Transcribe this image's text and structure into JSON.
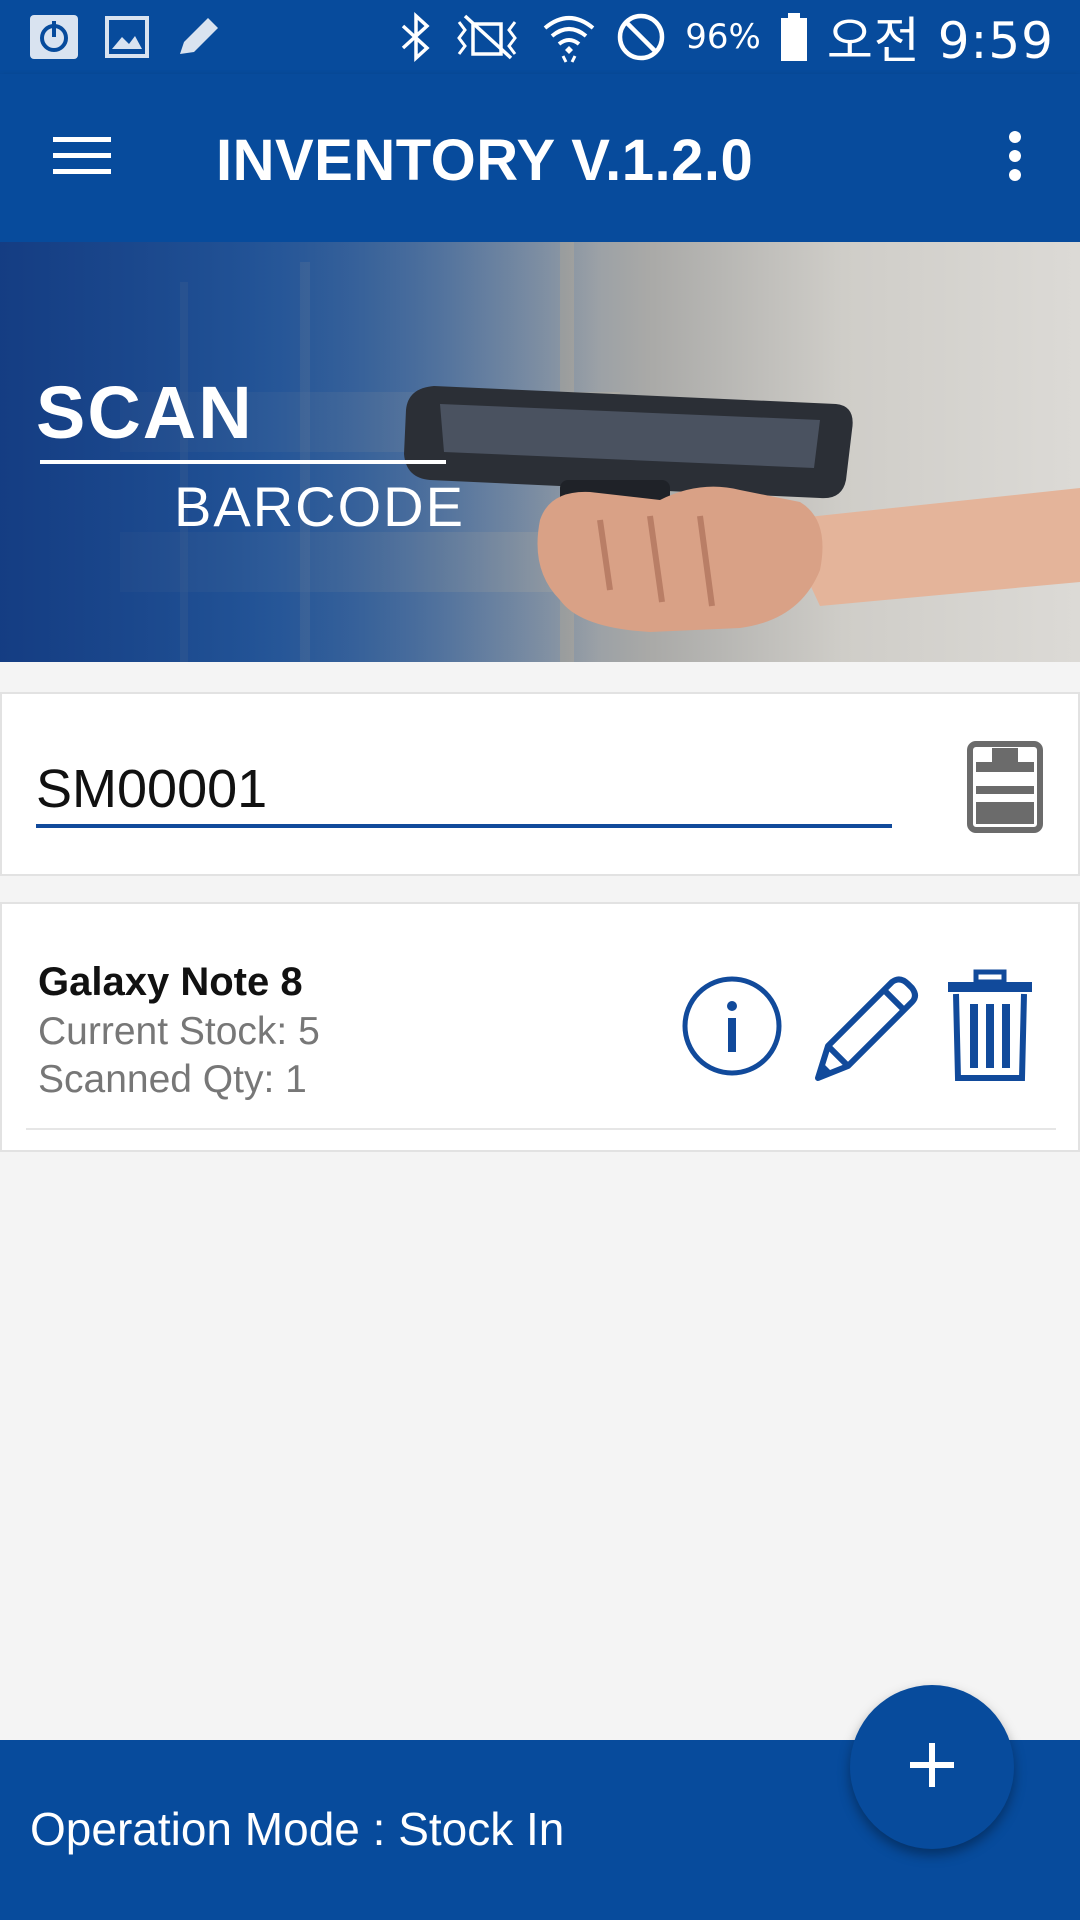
{
  "status_bar": {
    "left_icons": [
      "power-icon",
      "image-icon",
      "pencil-icon"
    ],
    "right_icons": [
      "bluetooth-icon",
      "vibrate-off-icon",
      "wifi-icon",
      "do-not-disturb-icon",
      "battery-icon"
    ],
    "battery_percent": "96%",
    "time": "오전 9:59"
  },
  "app_bar": {
    "title": "INVENTORY V.1.2.0",
    "menu_icon": "hamburger-menu-icon",
    "overflow_icon": "more-vert-icon"
  },
  "banner": {
    "title": "SCAN",
    "subtitle": "BARCODE"
  },
  "barcode": {
    "value": "SM00001",
    "scan_icon": "barcode-scanner-icon"
  },
  "items": [
    {
      "name": "Galaxy Note 8",
      "current_stock": "Current Stock: 5",
      "scanned_qty": "Scanned Qty: 1",
      "actions": [
        "info-icon",
        "edit-icon",
        "delete-icon"
      ]
    }
  ],
  "footer": {
    "mode_text": "Operation Mode : Stock In"
  },
  "fab": {
    "icon": "add-icon"
  },
  "colors": {
    "primary": "#074b9c",
    "accent": "#114a9b",
    "background": "#f4f4f4",
    "secondary_text": "#777777"
  }
}
